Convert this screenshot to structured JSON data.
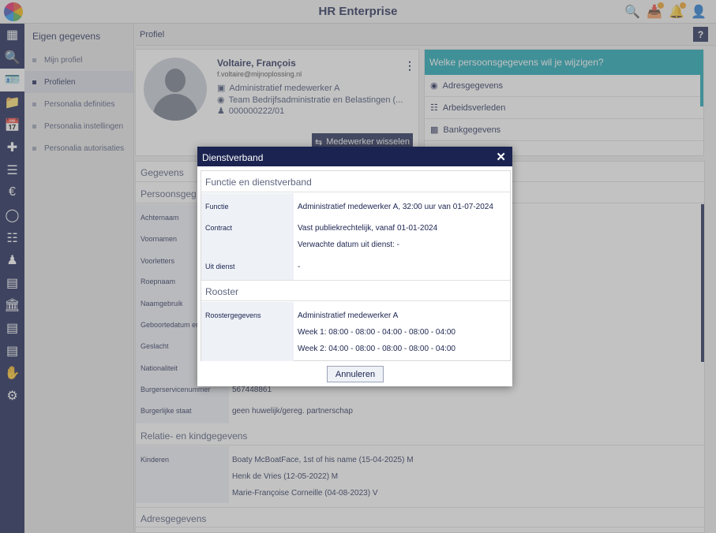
{
  "app": {
    "title": "HR Enterprise"
  },
  "header_icons": [
    "search-user-icon",
    "inbox-icon",
    "bell-icon",
    "user-icon"
  ],
  "rail": {
    "items": [
      "dashboard-icon",
      "search-icon",
      "id-card-icon",
      "folder-icon",
      "calendar-icon",
      "medical-bag-icon",
      "checklist-icon",
      "money-bag-icon",
      "euro-coin-icon",
      "schedule-icon",
      "person-icon",
      "briefcase-icon",
      "bank-icon",
      "document-icon",
      "file-list-icon",
      "hand-money-icon",
      "gear-icon"
    ]
  },
  "sidebar": {
    "title": "Eigen gegevens",
    "items": [
      {
        "label": "Mijn profiel"
      },
      {
        "label": "Profielen"
      },
      {
        "label": "Personalia definities"
      },
      {
        "label": "Personalia instellingen"
      },
      {
        "label": "Personalia autorisaties"
      }
    ]
  },
  "breadcrumb": {
    "label": "Profiel",
    "help": "?"
  },
  "profile": {
    "name": "Voltaire, François",
    "email": "f.voltaire@mijnoplossing.nl",
    "role": "Administratief medewerker A",
    "team": "Team Bedrijfsadministratie en Belastingen (...",
    "id": "000000222/01",
    "switch_label": "Medewerker wisselen"
  },
  "change_panel": {
    "title": "Welke persoonsgegevens wil je wijzigen?",
    "items": [
      {
        "label": "Adresgegevens"
      },
      {
        "label": "Arbeidsverleden"
      },
      {
        "label": "Bankgegevens"
      }
    ]
  },
  "data": {
    "header": "Gegevens",
    "personal_header": "Persoonsgeg",
    "rows": [
      {
        "label": "Achternaam",
        "value": ""
      },
      {
        "label": "Voornamen",
        "value": ""
      },
      {
        "label": "Voorletters",
        "value": ""
      },
      {
        "label": "Roepnaam",
        "value": ""
      },
      {
        "label": "Naamgebruik",
        "value": ""
      },
      {
        "label": "Geboortedatum en",
        "value": ""
      },
      {
        "label": "Geslacht",
        "value": ""
      },
      {
        "label": "Nationaliteit",
        "value": ""
      },
      {
        "label": "Burgerservicenummer",
        "value": "567448861"
      },
      {
        "label": "Burgerlijke staat",
        "value": "geen huwelijk/gereg. partnerschap"
      }
    ],
    "relations_header": "Relatie- en kindgegevens",
    "children_label": "Kinderen",
    "children": [
      "Boaty McBoatFace, 1st of his name (15-04-2025) M",
      "Henk de Vries (12-05-2022) M",
      "Marie-Françoise Corneille (04-08-2023) V"
    ],
    "address_header": "Adresgegevens"
  },
  "modal": {
    "title": "Dienstverband",
    "close": "✕",
    "section1": "Functie en dienstverband",
    "functie_label": "Functie",
    "functie_value": "Administratief medewerker A, 32:00 uur van 01-07-2024",
    "contract_label": "Contract",
    "contract_value": "Vast publiekrechtelijk, vanaf 01-01-2024",
    "contract_expected": "Verwachte datum uit dienst: -",
    "uitdienst_label": "Uit dienst",
    "uitdienst_value": "-",
    "section2": "Rooster",
    "rooster_label": "Roostergegevens",
    "rooster_lines": [
      "Administratief medewerker A",
      "Week 1: 08:00 - 08:00 - 04:00 - 08:00 - 04:00",
      "Week 2: 04:00 - 08:00 - 08:00 - 08:00 - 04:00"
    ],
    "cancel": "Annuleren"
  }
}
